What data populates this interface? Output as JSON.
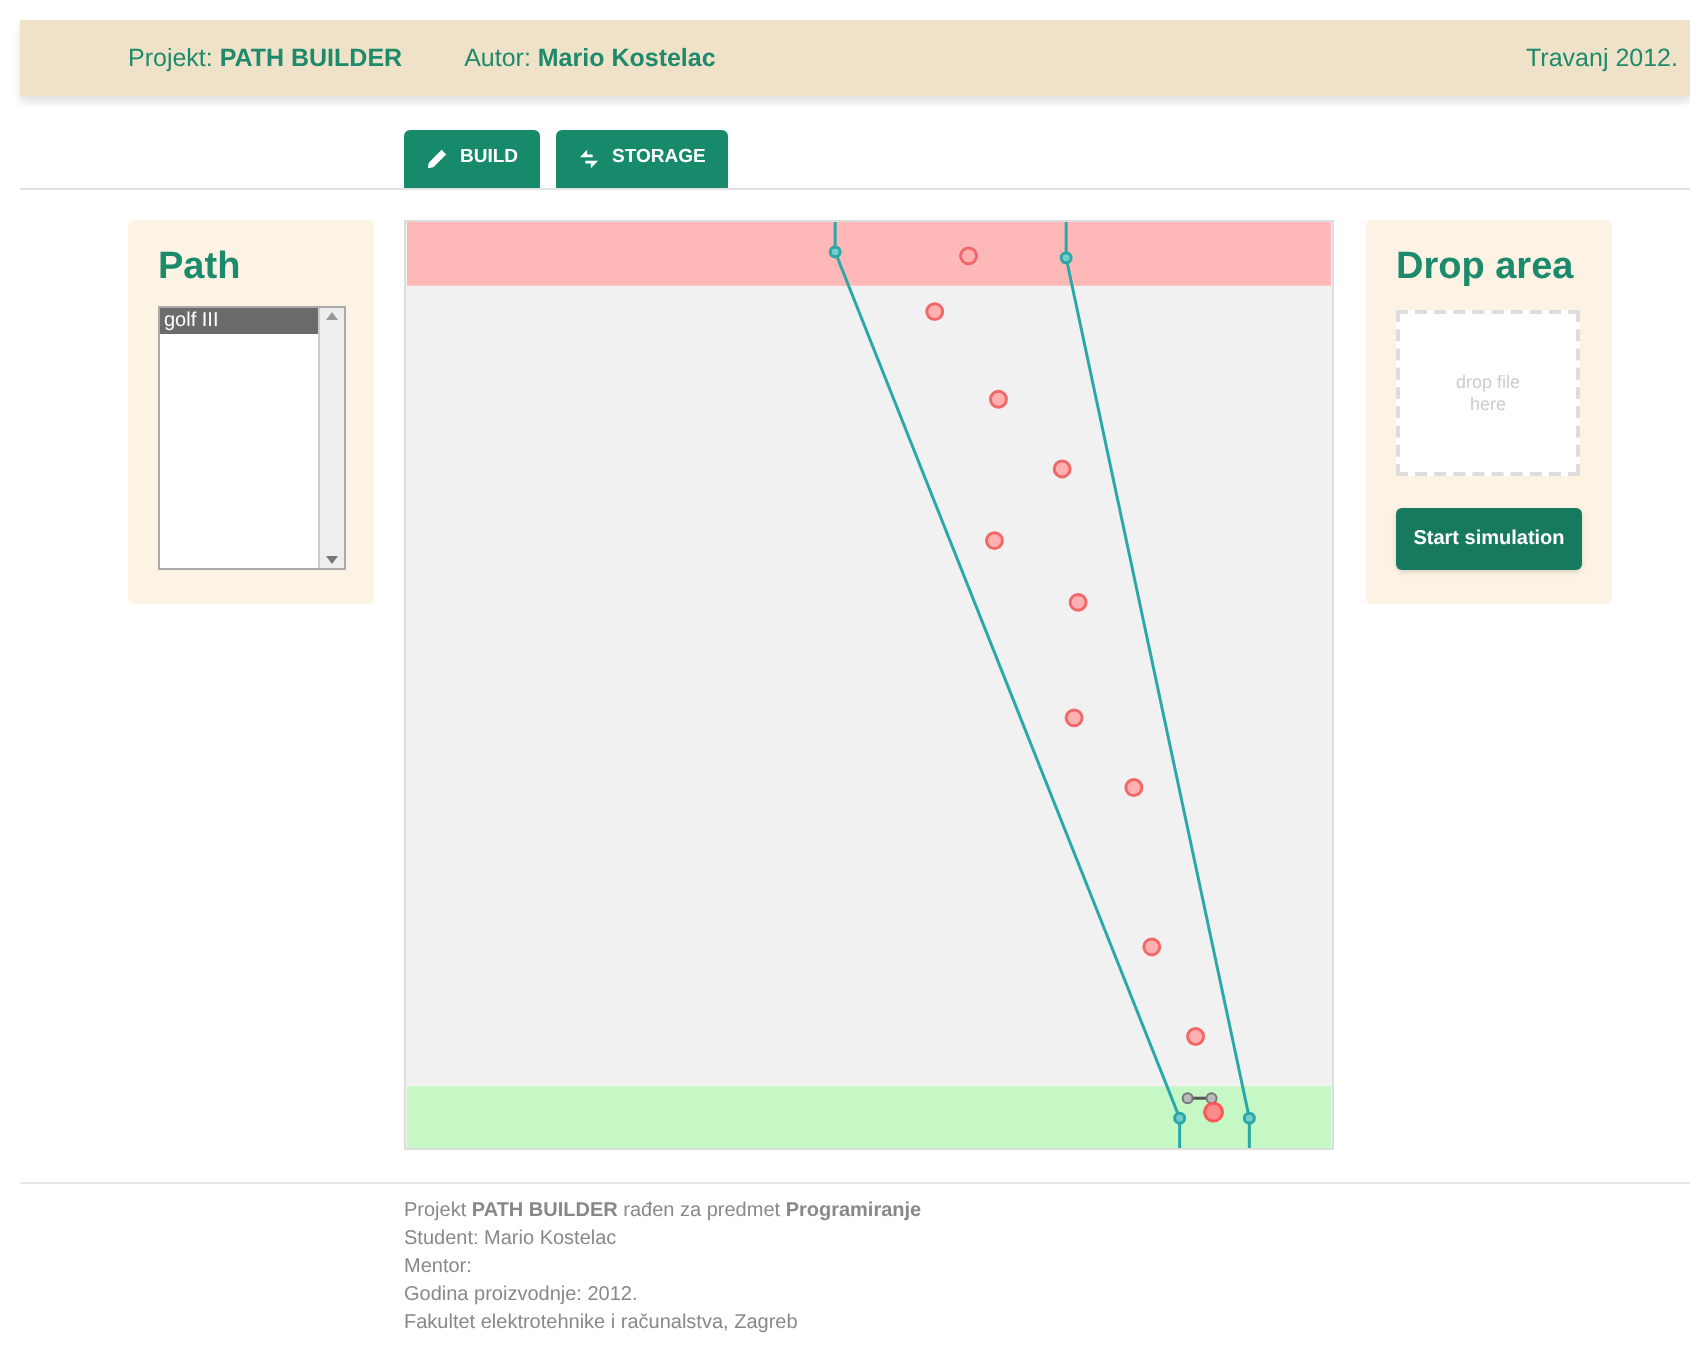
{
  "header": {
    "project_label": "Projekt:",
    "project_name": "PATH BUILDER",
    "author_label": "Autor:",
    "author_name": "Mario Kostelac",
    "date": "Travanj 2012."
  },
  "tabs": [
    {
      "label": "BUILD"
    },
    {
      "label": "STORAGE"
    }
  ],
  "path_panel": {
    "title": "Path",
    "items": [
      {
        "label": "golf III",
        "selected": true
      }
    ]
  },
  "drop_panel": {
    "title": "Drop area",
    "placeholder": "drop file here",
    "button": "Start simulation"
  },
  "footer": [
    "Projekt **PATH BUILDER** rađen za predmet **Programiranje**",
    "Student: Mario Kostelac",
    "Mentor:",
    "Godina proizvodnje: 2012.",
    "Fakultet elektrotehnike i računalstva, Zagreb"
  ]
}
